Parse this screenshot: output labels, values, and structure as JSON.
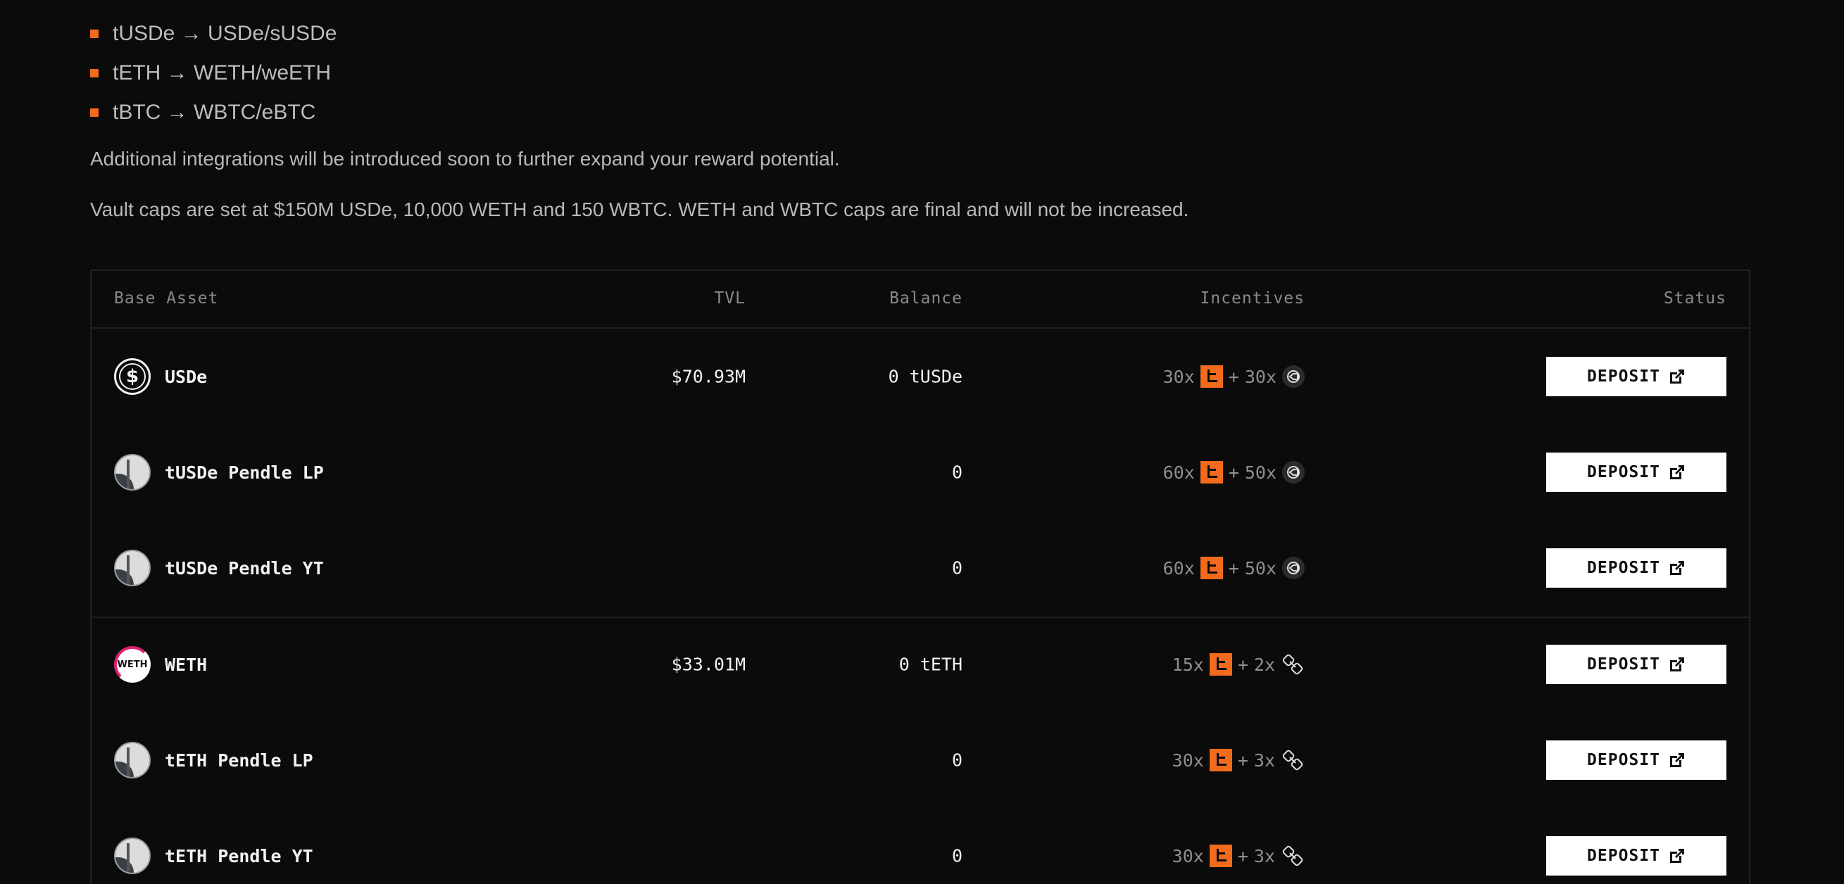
{
  "bullets": [
    "tUSDe → USDe/sUSDe",
    "tETH → WETH/weETH",
    "tBTC → WBTC/eBTC"
  ],
  "paragraphs": {
    "integrations": "Additional integrations will be introduced soon to further expand your reward potential.",
    "caps": "Vault caps are set at $150M USDe, 10,000 WETH and 150 WBTC. WETH and WBTC caps are final and will not be increased."
  },
  "table": {
    "headers": {
      "base_asset": "Base Asset",
      "tvl": "TVL",
      "balance": "Balance",
      "incentives": "Incentives",
      "status": "Status"
    },
    "rows": [
      {
        "name": "USDe",
        "icon": "usde-dollar-icon",
        "tvl": "$70.93M",
        "balance": "0 tUSDe",
        "mult1": "30x",
        "plus": "+",
        "mult2": "30x",
        "partner_icon": "ethena-coin-icon",
        "action": "DEPOSIT"
      },
      {
        "name": "tUSDe Pendle LP",
        "icon": "pendle-icon",
        "tvl": "",
        "balance": "0",
        "mult1": "60x",
        "plus": "+",
        "mult2": "50x",
        "partner_icon": "ethena-coin-icon",
        "action": "DEPOSIT"
      },
      {
        "name": "tUSDe Pendle YT",
        "icon": "pendle-icon",
        "tvl": "",
        "balance": "0",
        "mult1": "60x",
        "plus": "+",
        "mult2": "50x",
        "partner_icon": "ethena-coin-icon",
        "action": "DEPOSIT"
      },
      {
        "name": "WETH",
        "icon": "weth-icon",
        "weth_label": "WETH",
        "tvl": "$33.01M",
        "balance": "0 tETH",
        "mult1": "15x",
        "plus": "+",
        "mult2": "2x",
        "partner_icon": "link-chain-icon",
        "action": "DEPOSIT"
      },
      {
        "name": "tETH Pendle LP",
        "icon": "pendle-icon",
        "tvl": "",
        "balance": "0",
        "mult1": "30x",
        "plus": "+",
        "mult2": "3x",
        "partner_icon": "link-chain-icon",
        "action": "DEPOSIT"
      },
      {
        "name": "tETH Pendle YT",
        "icon": "pendle-icon",
        "tvl": "",
        "balance": "0",
        "mult1": "30x",
        "plus": "+",
        "mult2": "3x",
        "partner_icon": "link-chain-icon",
        "action": "DEPOSIT"
      }
    ]
  },
  "colors": {
    "background": "#0b0b0b",
    "accent": "#f26b1d",
    "text": "#bdbdbd",
    "button_bg": "#ffffff"
  }
}
